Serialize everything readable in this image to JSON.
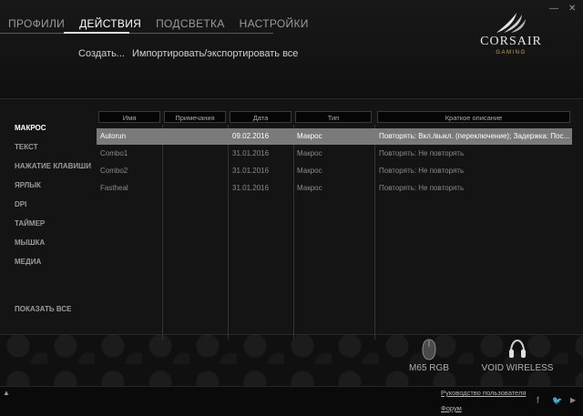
{
  "tabs": [
    {
      "label": "ПРОФИЛИ"
    },
    {
      "label": "ДЕЙСТВИЯ"
    },
    {
      "label": "ПОДСВЕТКА"
    },
    {
      "label": "НАСТРОЙКИ"
    }
  ],
  "active_tab_index": 1,
  "window_controls": {
    "minimize": "—",
    "close": "✕"
  },
  "sub_actions": {
    "create": "Создать...",
    "import_export": "Импортировать/экспортировать все"
  },
  "logo": {
    "brand": "CORSAIR",
    "sub": "GAMING"
  },
  "sidebar": {
    "items": [
      {
        "label": "МАКРОС"
      },
      {
        "label": "ТЕКСТ"
      },
      {
        "label": "НАЖАТИЕ КЛАВИШИ"
      },
      {
        "label": "ЯРЛЫК"
      },
      {
        "label": "DPI"
      },
      {
        "label": "ТАЙМЕР"
      },
      {
        "label": "МЫШКА"
      },
      {
        "label": "МЕДИА"
      }
    ],
    "active_index": 0,
    "show_all": "ПОКАЗАТЬ ВСЕ"
  },
  "table": {
    "headers": [
      "Имя",
      "Примечания",
      "Дата",
      "Тип",
      "Краткое описание"
    ],
    "rows": [
      {
        "name": "Autorun",
        "notes": "",
        "date": "09.02.2016",
        "type": "Макрос",
        "desc": "Повторять: Вкл./выкл. (переключение); Задержка: Пос..."
      },
      {
        "name": "Combo1",
        "notes": "",
        "date": "31.01.2016",
        "type": "Макрос",
        "desc": "Повторять: Не повторять"
      },
      {
        "name": "Combo2",
        "notes": "",
        "date": "31.01.2016",
        "type": "Макрос",
        "desc": "Повторять: Не повторять"
      },
      {
        "name": "Fastheal",
        "notes": "",
        "date": "31.01.2016",
        "type": "Макрос",
        "desc": "Повторять: Не повторять"
      }
    ],
    "selected_index": 0
  },
  "devices": [
    {
      "label": "M65 RGB",
      "icon": "mouse-icon"
    },
    {
      "label": "VOID WIRELESS",
      "icon": "headset-icon"
    }
  ],
  "footer": {
    "up_arrow": "▲",
    "user_guide": "Руководство пользователя",
    "forum": "Форум",
    "social": [
      {
        "name": "facebook-icon",
        "glyph": "f"
      },
      {
        "name": "twitter-icon",
        "glyph": "🐦"
      },
      {
        "name": "youtube-icon",
        "glyph": "▶"
      }
    ]
  }
}
